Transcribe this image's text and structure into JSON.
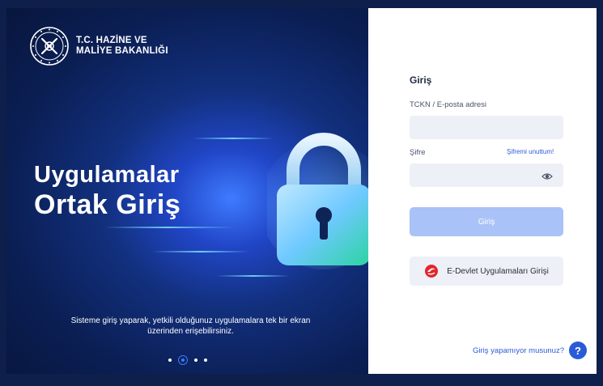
{
  "brand": {
    "line1": "T.C. HAZİNE VE",
    "line2": "MALİYE BAKANLIĞI",
    "emblem_icon": "ministry-emblem-icon"
  },
  "hero": {
    "title_line1": "Uygulamalar",
    "title_line2": "Ortak Giriş",
    "description": "Sisteme giriş yaparak, yetkili olduğunuz uygulamalara tek bir ekran üzerinden erişebilirsiniz.",
    "carousel_active_index": 1,
    "carousel_count": 4
  },
  "form": {
    "title": "Giriş",
    "username_label": "TCKN / E-posta adresi",
    "username_value": "",
    "password_label": "Şifre",
    "password_value": "",
    "forgot_link": "Şifremi unuttum!",
    "submit_label": "Giriş",
    "edevlet_label": "E-Devlet Uygulamaları Girişi",
    "help_link": "Giriş yapamıyor musunuz?",
    "help_icon_glyph": "?"
  },
  "colors": {
    "accent": "#2a5bd7",
    "submit_disabled": "#a9c2f7",
    "input_bg": "#eef0f7",
    "edevlet_red": "#e3262d"
  }
}
